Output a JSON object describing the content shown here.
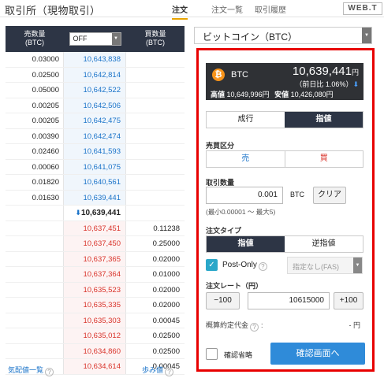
{
  "header": {
    "title": "取引所（現物取引）",
    "tabs": [
      "注文",
      "注文一覧",
      "取引履歴"
    ],
    "logo": "WEB.T"
  },
  "orderbook": {
    "col_ask": "売数量\n(BTC)",
    "col_bid": "買数量\n(BTC)",
    "filter": "OFF",
    "asks": [
      {
        "qty": "0.03000",
        "price": "10,643,838"
      },
      {
        "qty": "0.02500",
        "price": "10,642,814"
      },
      {
        "qty": "0.05000",
        "price": "10,642,522"
      },
      {
        "qty": "0.00205",
        "price": "10,642,506"
      },
      {
        "qty": "0.00205",
        "price": "10,642,475"
      },
      {
        "qty": "0.00390",
        "price": "10,642,474"
      },
      {
        "qty": "0.02460",
        "price": "10,641,593"
      },
      {
        "qty": "0.00060",
        "price": "10,641,075"
      },
      {
        "qty": "0.01820",
        "price": "10,640,561"
      },
      {
        "qty": "0.01630",
        "price": "10,639,441"
      }
    ],
    "mid": {
      "arrow": "⬇",
      "price": "10,639,441"
    },
    "bids": [
      {
        "price": "10,637,451",
        "qty": "0.11238"
      },
      {
        "price": "10,637,450",
        "qty": "0.25000"
      },
      {
        "price": "10,637,365",
        "qty": "0.02000"
      },
      {
        "price": "10,637,364",
        "qty": "0.01000"
      },
      {
        "price": "10,635,523",
        "qty": "0.02000"
      },
      {
        "price": "10,635,335",
        "qty": "0.02000"
      },
      {
        "price": "10,635,303",
        "qty": "0.00045"
      },
      {
        "price": "10,635,012",
        "qty": "0.02500"
      },
      {
        "price": "10,634,860",
        "qty": "0.02500"
      },
      {
        "price": "10,634,614",
        "qty": "0.00045"
      }
    ],
    "link_left": "気配値一覧",
    "link_right": "歩み値"
  },
  "order": {
    "pair": "ビットコイン（BTC）",
    "ticker": {
      "symbol": "BTC",
      "price": "10,639,441",
      "unit": "円",
      "change": "（前日比 1.06%）",
      "arrow": "⬇",
      "high_label": "高値",
      "high": "10,649,996円",
      "low_label": "安値",
      "low": "10,426,080円"
    },
    "order_mode": [
      "成行",
      "指値"
    ],
    "side_label": "売買区分",
    "sides": [
      "売",
      "買"
    ],
    "qty_label": "取引数量",
    "qty": "0.001",
    "qty_unit": "BTC",
    "clear": "クリア",
    "qty_hint": "(最小0.00001 〜 最大5)",
    "type_label": "注文タイプ",
    "types": [
      "指値",
      "逆指値"
    ],
    "post_only": "Post-Only",
    "fas": "指定なし(FAS)",
    "rate_label": "注文レート（円）",
    "minus": "−100",
    "rate": "10615000",
    "plus": "+100",
    "estimate_label": "概算約定代金",
    "estimate_value": "- 円",
    "skip_label": "確認省略",
    "confirm": "確認画面へ"
  },
  "colors": {
    "accent_red": "#e80000",
    "ask_red": "#d9342b",
    "bid_blue": "#1a73c9",
    "dark": "#2d3545",
    "button_blue": "#2f8bd9"
  }
}
